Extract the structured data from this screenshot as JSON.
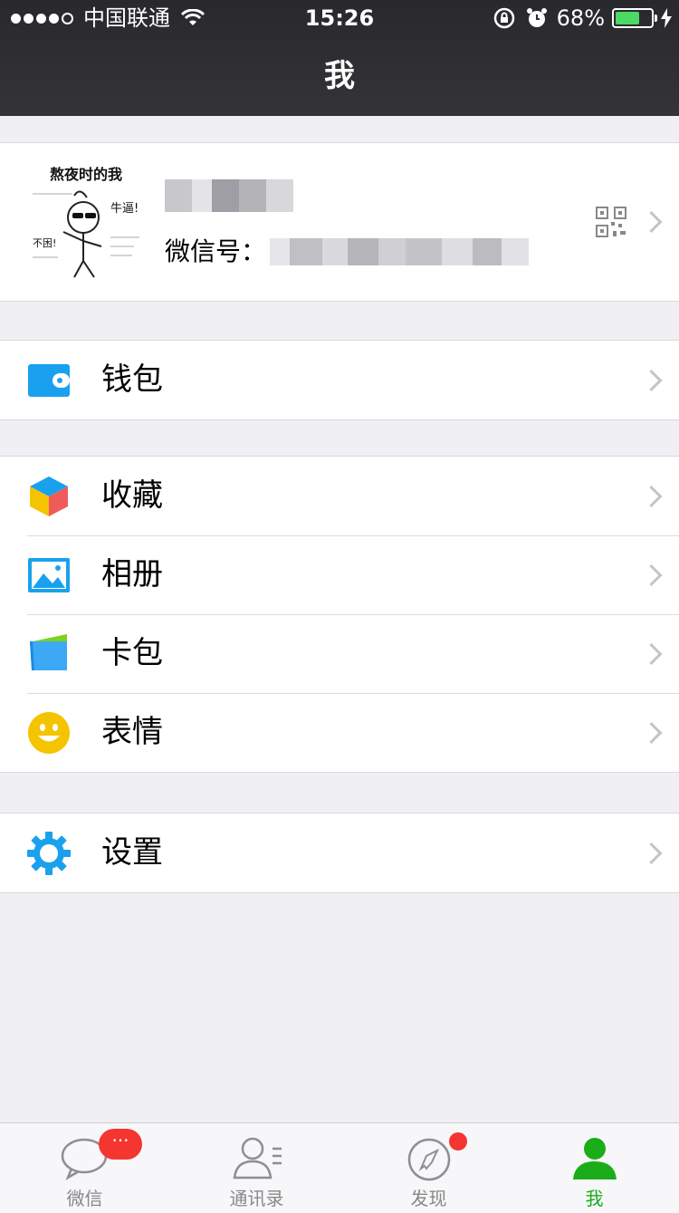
{
  "status_bar": {
    "signal_dots": 5,
    "signal_filled": 4,
    "carrier": "中国联通",
    "time": "15:26",
    "battery_text": "68%",
    "battery_level": 0.68
  },
  "header": {
    "title": "我"
  },
  "profile": {
    "avatar_caption": "熬夜时的我",
    "avatar_bubble_1": "牛逼!",
    "avatar_bubble_2": "不困!",
    "wechat_id_label": "微信号："
  },
  "menu": {
    "wallet": "钱包",
    "favorites": "收藏",
    "album": "相册",
    "cards": "卡包",
    "stickers": "表情",
    "settings": "设置"
  },
  "tabbar": {
    "chats": {
      "label": "微信",
      "badge": "···"
    },
    "contacts": {
      "label": "通讯录"
    },
    "discover": {
      "label": "发现"
    },
    "me": {
      "label": "我"
    }
  },
  "colors": {
    "nav_bg": "#2e2e32",
    "page_bg": "#efeff4",
    "accent_green": "#1aad19",
    "badge_red": "#f43530",
    "icon_blue": "#1aa1ee",
    "emoji_yellow": "#f5c400"
  }
}
